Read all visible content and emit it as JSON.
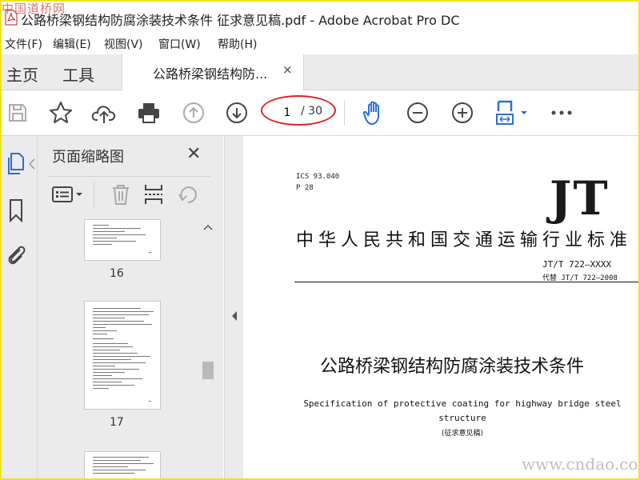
{
  "window": {
    "title": "公路桥梁钢结构防腐涂装技术条件 征求意见稿.pdf - Adobe Acrobat Pro DC",
    "watermark_top": "中国道桥网"
  },
  "menu": {
    "items": [
      "文件(F)",
      "编辑(E)",
      "视图(V)",
      "窗口(W)",
      "帮助(H)"
    ]
  },
  "tabs": {
    "home": "主页",
    "tools": "工具",
    "document": "公路桥梁钢结构防...",
    "close": "×"
  },
  "toolbar": {
    "icons": [
      "save-icon",
      "star-icon",
      "cloud-upload-icon",
      "print-icon",
      "page-up-icon",
      "page-down-icon",
      "hand-icon",
      "zoom-out-icon",
      "zoom-in-icon",
      "fit-page-icon",
      "more-icon"
    ],
    "page_current": "1",
    "page_total": "/ 30"
  },
  "left_nav": {
    "icons": [
      "thumbnails-icon",
      "bookmark-icon",
      "attachment-icon"
    ]
  },
  "thumbnails": {
    "title": "页面缩略图",
    "close": "✕",
    "pages": [
      {
        "number": "16"
      },
      {
        "number": "17"
      }
    ]
  },
  "document": {
    "ics": "ICS 93.040",
    "category": "P 28",
    "logo": "JT",
    "industry_standard": "中华人民共和国交通运输行业标准",
    "standard_number": "JT/T 722—XXXX",
    "replaces": "代替 JT/T 722—2008",
    "title_cn": "公路桥梁钢结构防腐涂装技术条件",
    "title_en": "Specification of protective coating for highway bridge steel structure",
    "draft_note": "(征求意见稿)"
  },
  "watermark_bottom": "www.cndao.com",
  "colors": {
    "accent_blue": "#2d6dd2",
    "annotation_red": "#e21f26",
    "frame_yellow": "#f2e21a"
  }
}
